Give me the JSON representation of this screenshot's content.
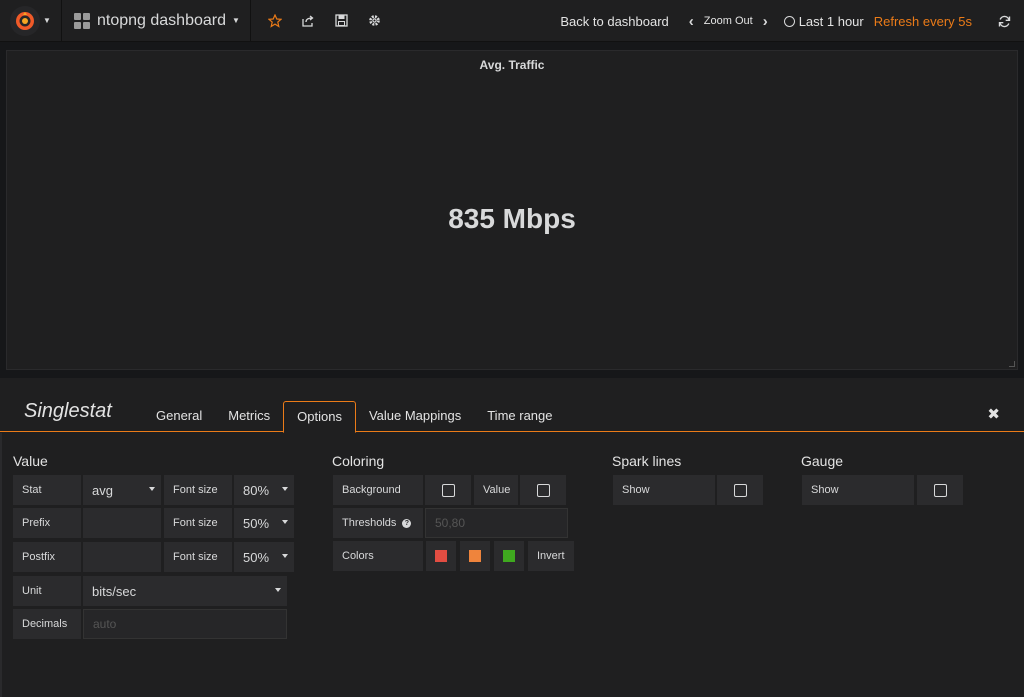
{
  "navbar": {
    "dashboard_title": "ntopng dashboard",
    "back_label": "Back to dashboard",
    "zoom_out_label": "Zoom Out",
    "time_range_label": "Last 1 hour",
    "refresh_label": "Refresh every 5s"
  },
  "panel": {
    "title": "Avg. Traffic",
    "value": "835 Mbps"
  },
  "editor": {
    "type_label": "Singlestat",
    "tabs": [
      "General",
      "Metrics",
      "Options",
      "Value Mappings",
      "Time range"
    ],
    "active_tab": "Options",
    "close_label": "✖"
  },
  "value_section": {
    "title": "Value",
    "stat_label": "Stat",
    "stat_value": "avg",
    "prefix_label": "Prefix",
    "prefix_value": "",
    "postfix_label": "Postfix",
    "postfix_value": "",
    "font_size_label": "Font size",
    "stat_font_size": "80%",
    "prefix_font_size": "50%",
    "postfix_font_size": "50%",
    "unit_label": "Unit",
    "unit_value": "bits/sec",
    "decimals_label": "Decimals",
    "decimals_placeholder": "auto"
  },
  "coloring_section": {
    "title": "Coloring",
    "background_label": "Background",
    "background_checked": false,
    "value_label": "Value",
    "value_checked": false,
    "thresholds_label": "Thresholds",
    "thresholds_placeholder": "50,80",
    "colors_label": "Colors",
    "colors": [
      "#e24d42",
      "#ef843c",
      "#3fa91f"
    ],
    "invert_label": "Invert"
  },
  "sparklines_section": {
    "title": "Spark lines",
    "show_label": "Show",
    "checked": false
  },
  "gauge_section": {
    "title": "Gauge",
    "show_label": "Show",
    "checked": false
  },
  "colors": {
    "accent": "#eb7b18",
    "background": "#161719",
    "panel": "#1f1f20"
  }
}
